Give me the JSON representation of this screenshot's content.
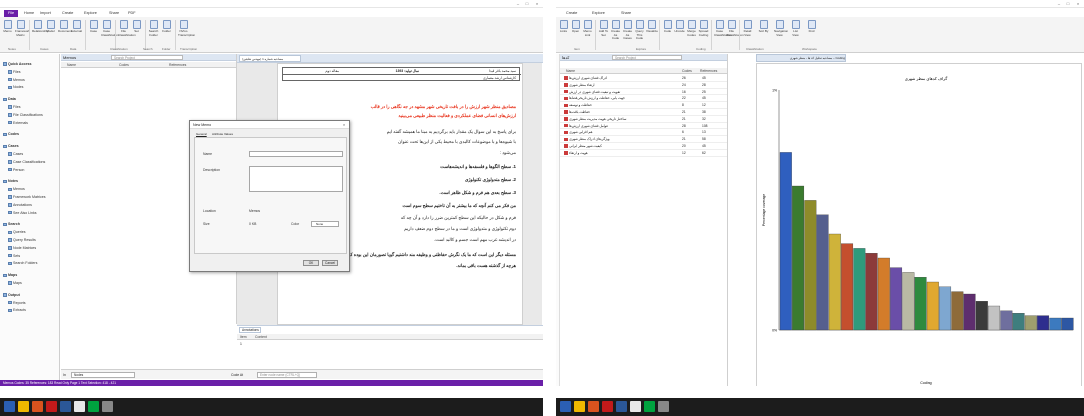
{
  "left_window": {
    "tabs": [
      "File",
      "Home",
      "Import",
      "Create",
      "Explore",
      "Share",
      "PDF"
    ],
    "ribbon_buttons": [
      "Memo",
      "Framework Matrix",
      "Relationship",
      "Model",
      "Document",
      "External",
      "Case",
      "Case Classification",
      "File Classification",
      "Set",
      "Search Folder",
      "Folder",
      "NVivo Transcription"
    ],
    "ribbon_groups": [
      "Notes",
      "Cases",
      "Data",
      "Classification",
      "Search",
      "Folder",
      "Transcription"
    ],
    "nav": [
      {
        "label": "Quick Access",
        "header": true
      },
      {
        "label": "Files"
      },
      {
        "label": "Memos"
      },
      {
        "label": "Nodes"
      },
      {
        "label": "Data",
        "header": true
      },
      {
        "label": "Files"
      },
      {
        "label": "File Classifications"
      },
      {
        "label": "Externals"
      },
      {
        "label": "Codes",
        "header": true
      },
      {
        "label": "Cases",
        "header": true
      },
      {
        "label": "Cases"
      },
      {
        "label": "Case Classifications"
      },
      {
        "label": "Person"
      },
      {
        "label": "Notes",
        "header": true
      },
      {
        "label": "Memos"
      },
      {
        "label": "Framework Matrices"
      },
      {
        "label": "Annotations"
      },
      {
        "label": "See Also Links"
      },
      {
        "label": "Search",
        "header": true
      },
      {
        "label": "Queries"
      },
      {
        "label": "Query Results"
      },
      {
        "label": "Node Matrices"
      },
      {
        "label": "Sets"
      },
      {
        "label": "Search Folders"
      },
      {
        "label": "Maps",
        "header": true
      },
      {
        "label": "Maps"
      },
      {
        "label": "Output",
        "header": true
      },
      {
        "label": "Reports"
      },
      {
        "label": "Extracts"
      }
    ],
    "memos_title": "Memos",
    "search_placeholder": "Search Project",
    "list_cols": [
      "Name",
      "Codes",
      "References"
    ],
    "annotations_title": "Annotations",
    "annotation_cols": [
      "Item",
      "Content"
    ],
    "annotation_item": "1",
    "code_at_label": "Code At",
    "nodes_label": "Nodes",
    "enter_code": "Enter node name (CTRL+Q)",
    "status": "Memos   Codes: 35  References: 183    Read Only    Page 1   Text Selection: 418 - 421",
    "doc_header": [
      "مقاله دوم",
      "سال تولید: 1393",
      "سید محمد باقر قیدا",
      "کارشناس ارشد معماری"
    ],
    "doc_lines": [
      {
        "text": "مصادیق منظر شهر  ارزش را در بافت تاریخی شهر مشهد در جه نگاهی را در قالب",
        "red": true
      },
      {
        "text": "ارزش‌های انسانی فضای عملکردی و فعالیت منظر طبیعی می‌بینید",
        "red": true
      },
      {
        "text": "برای پاسخ به این سوال یک مقدار باید برگردیم به مبنا ما همیشه گفته ایم",
        "red": false
      },
      {
        "text": "با شیوه‌ها و با موضوعات کالبدی با محیط یکی از این‌ها تحت عنوان",
        "red": false
      },
      {
        "text": "می‌شود :",
        "red": false
      },
      {
        "text": "1.  سطح الگوها و فلسفه‌ها و اندیشه‌هاست",
        "red": false,
        "bold": true
      },
      {
        "text": "2.  سطح متدولوژی تکنولوژی",
        "red": false,
        "bold": true
      },
      {
        "text": "3.  سطح بعدی هم فرم و شکل ظاهر است.",
        "red": false,
        "bold": true
      },
      {
        "text": "من فکر می کنم آنچه که ما بیشتر به آن تاختیم سطح سوم است",
        "red": false,
        "bold": true
      },
      {
        "text": "فرم و شکل در حالیکه این سطح کمترین ضرر را دارد و آن چه که",
        "red": false
      },
      {
        "text": "دوم تکنولوژی و متدولوژی است و ما در سطح دوم ضعف داریم",
        "red": false
      },
      {
        "text": "در اندیشه غرب مهم است جسم و کالبد است.",
        "red": false
      },
      {
        "text": "مسئله دیگر این است که ما یک نگرش حفاظتی و وظیفه مند داشتیم گویا تصورمان این بوده که",
        "red": false,
        "bold": true
      },
      {
        "text": "هرچه از گذشته هست باقی بماند.",
        "red": false,
        "bold": true
      }
    ],
    "dialog": {
      "title": "New Memo",
      "tabs": [
        "General",
        "Attribute Values"
      ],
      "name_label": "Name",
      "desc_label": "Description",
      "location_label": "Location",
      "location_value": "Memos",
      "size_label": "Size",
      "size_value": "0 KB",
      "color_label": "Color",
      "color_value": "None",
      "ok": "OK",
      "cancel": "Cancel"
    },
    "taskbar_icons": [
      "windows-icon",
      "explorer-icon",
      "media-icon",
      "acrobat-icon",
      "word-icon",
      "chrome-icon",
      "nvivo-icon",
      "settings-icon"
    ]
  },
  "right_window": {
    "tabs": [
      "Create",
      "Explore",
      "Share"
    ],
    "ribbon_buttons": [
      "Links",
      "Open",
      "Memo Link",
      "Add To Set",
      "Create As Code",
      "Create As Cases",
      "Query This Code",
      "Visualize",
      "Code",
      "Uncode",
      "Merge Codes",
      "Spread Coding",
      "Case Classification",
      "File Classification",
      "Detail View",
      "Sort By",
      "Navigation View",
      "List View",
      "Find"
    ],
    "ribbon_groups": [
      "Item",
      "Explore",
      "Coding",
      "Classification",
      "Workspace"
    ],
    "list_title": "کدها",
    "search_placeholder": "Search Project",
    "list_cols": [
      "Name",
      "Codes",
      "References"
    ],
    "codes": [
      {
        "name": "ادراک فضای شهری ارزش‌ها",
        "codes": "26",
        "refs": "45"
      },
      {
        "name": "ارتقاء منظر شهری",
        "codes": "24",
        "refs": "28"
      },
      {
        "name": "تقویت و تبعیت فضای شهری در ارزش",
        "codes": "16",
        "refs": "25"
      },
      {
        "name": "جهت ‌یابی، حفاظت و ارزش تاریخی‌فضاها",
        "codes": "22",
        "refs": "45"
      },
      {
        "name": "حفاظت و توسعه",
        "codes": "8",
        "refs": "12"
      },
      {
        "name": "حفاظت بافت‌ها",
        "codes": "21",
        "refs": "38"
      },
      {
        "name": "ساختار تاریخی هویت مدیریت منظر شهری",
        "codes": "21",
        "refs": "32"
      },
      {
        "name": "عوامل فضای شهری ارزش‌ها",
        "codes": "28",
        "refs": "108"
      },
      {
        "name": "هم ‌افزایی شهری",
        "codes": "6",
        "refs": "13"
      },
      {
        "name": "ویژگی‌های ادراک منظر شهری",
        "codes": "21",
        "refs": "58"
      },
      {
        "name": "کیفیت شهر منظر ایرانی",
        "codes": "20",
        "refs": "45"
      },
      {
        "name": "هویت و ارتقاء",
        "codes": "12",
        "refs": "62"
      }
    ],
    "chart_tab": "Coding – مصاحبه تحلیل کد ها ، منظر شهری",
    "status": "",
    "taskbar_icons": [
      "windows-icon",
      "explorer-icon",
      "media-icon",
      "acrobat-icon",
      "word-icon",
      "chrome-icon",
      "nvivo-icon",
      "settings-icon"
    ]
  },
  "chart_data": {
    "type": "bar",
    "title": "گراف کدهای منظر شهری",
    "xlabel": "Coding",
    "ylabel": "Percentage coverage",
    "ylim": [
      0,
      1
    ],
    "ytick_labels": [
      "0%",
      "1%"
    ],
    "values": [
      0.74,
      0.6,
      0.54,
      0.48,
      0.4,
      0.36,
      0.34,
      0.32,
      0.3,
      0.26,
      0.24,
      0.22,
      0.2,
      0.18,
      0.16,
      0.15,
      0.12,
      0.1,
      0.08,
      0.07,
      0.06,
      0.06,
      0.05,
      0.05
    ],
    "colors": [
      "#2f5fbf",
      "#3b7b2f",
      "#8e8b2a",
      "#555f8e",
      "#cfb33a",
      "#c44f2e",
      "#2f9a7c",
      "#8c3a3a",
      "#d37c2a",
      "#6a4ea8",
      "#b9b9a4",
      "#2e8a3e",
      "#e0a830",
      "#7ea7d0",
      "#8e6b3a",
      "#5e2e6e",
      "#3b3b3b",
      "#c2c2c2",
      "#6f6f9e",
      "#3e7e7e",
      "#9e9e6e",
      "#2e2e8e",
      "#3c7abf",
      "#2d57a3"
    ]
  }
}
